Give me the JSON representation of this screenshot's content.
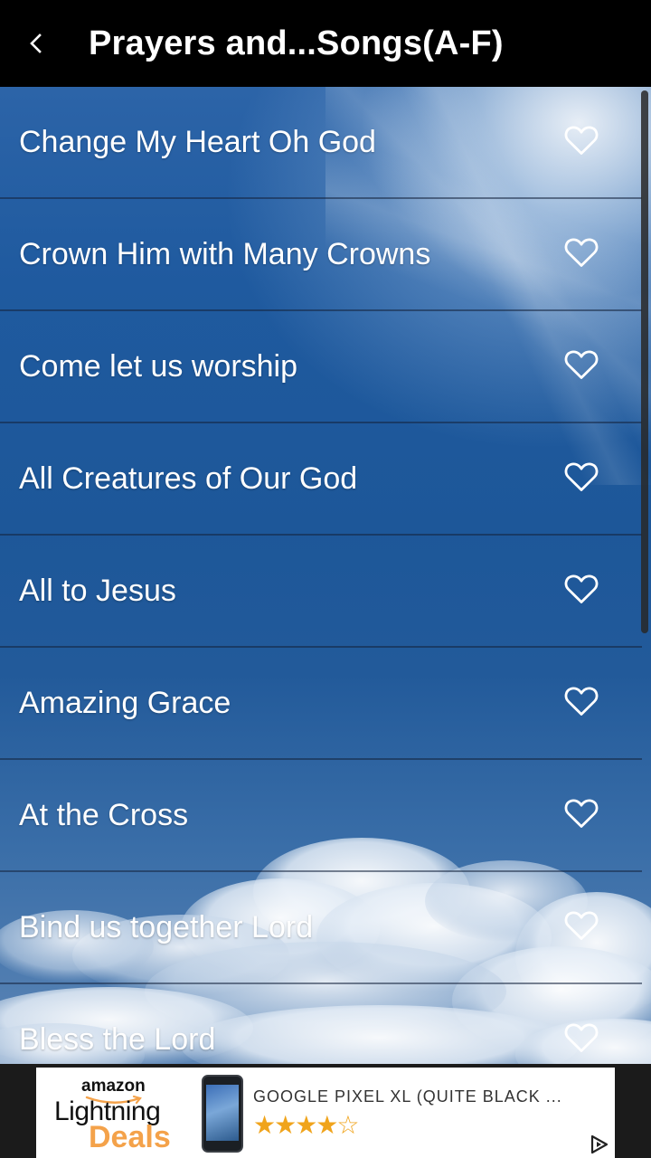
{
  "header": {
    "title": "Prayers and...Songs(A-F)"
  },
  "songs": [
    {
      "title": "Change My Heart Oh God"
    },
    {
      "title": "Crown Him with Many Crowns"
    },
    {
      "title": "Come let us worship"
    },
    {
      "title": "All Creatures of Our God"
    },
    {
      "title": "All to Jesus"
    },
    {
      "title": "Amazing Grace"
    },
    {
      "title": "At the Cross"
    },
    {
      "title": "Bind us together Lord"
    },
    {
      "title": "Bless the Lord"
    }
  ],
  "icons": {
    "back": "chevron-left-icon",
    "favorite": "heart-outline-icon",
    "ad_choices": "ad-choices-icon"
  },
  "ad": {
    "brand_top": "amazon",
    "brand_mid": "Lightning",
    "brand_bottom": "Deals",
    "product": "GOOGLE PIXEL XL (QUITE BLACK ...",
    "rating": 4,
    "rating_max": 5,
    "stars_text": "★★★★☆"
  },
  "colors": {
    "header_bg": "#000000",
    "deals_orange": "#f4a24a",
    "star_gold": "#f0a41c"
  }
}
